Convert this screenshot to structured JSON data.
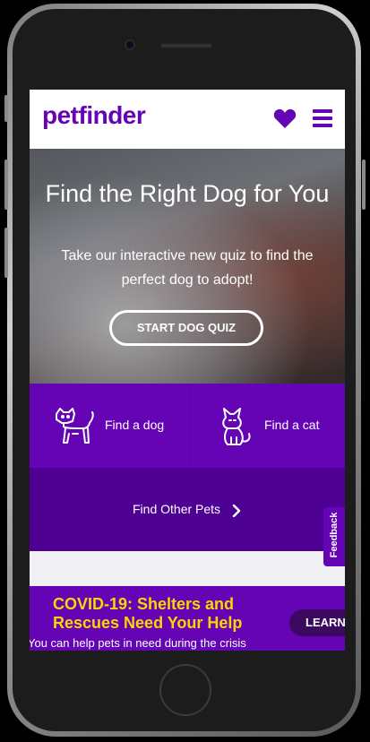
{
  "header": {
    "logo_text": "petfinder",
    "favorites_icon": "heart-icon",
    "menu_icon": "menu-icon"
  },
  "hero": {
    "title": "Find the Right Dog for You",
    "subtitle": "Take our interactive new quiz to find the perfect dog to adopt!",
    "cta_label": "START DOG QUIZ"
  },
  "tiles": {
    "dog": {
      "label": "Find a dog",
      "icon": "dog-icon"
    },
    "cat": {
      "label": "Find a cat",
      "icon": "cat-icon"
    },
    "other": {
      "label": "Find Other Pets",
      "icon": "chevron-right-icon"
    }
  },
  "banner": {
    "title": "COVID-19: Shelters and Rescues Need Your Help",
    "subtitle": "You can help pets in need during the crisis",
    "button_label": "LEARN"
  },
  "feedback_tab": {
    "label": "Feedback"
  },
  "colors": {
    "brand_purple": "#6504b5",
    "dark_purple": "#4d0091",
    "banner_yellow": "#ffd500"
  }
}
